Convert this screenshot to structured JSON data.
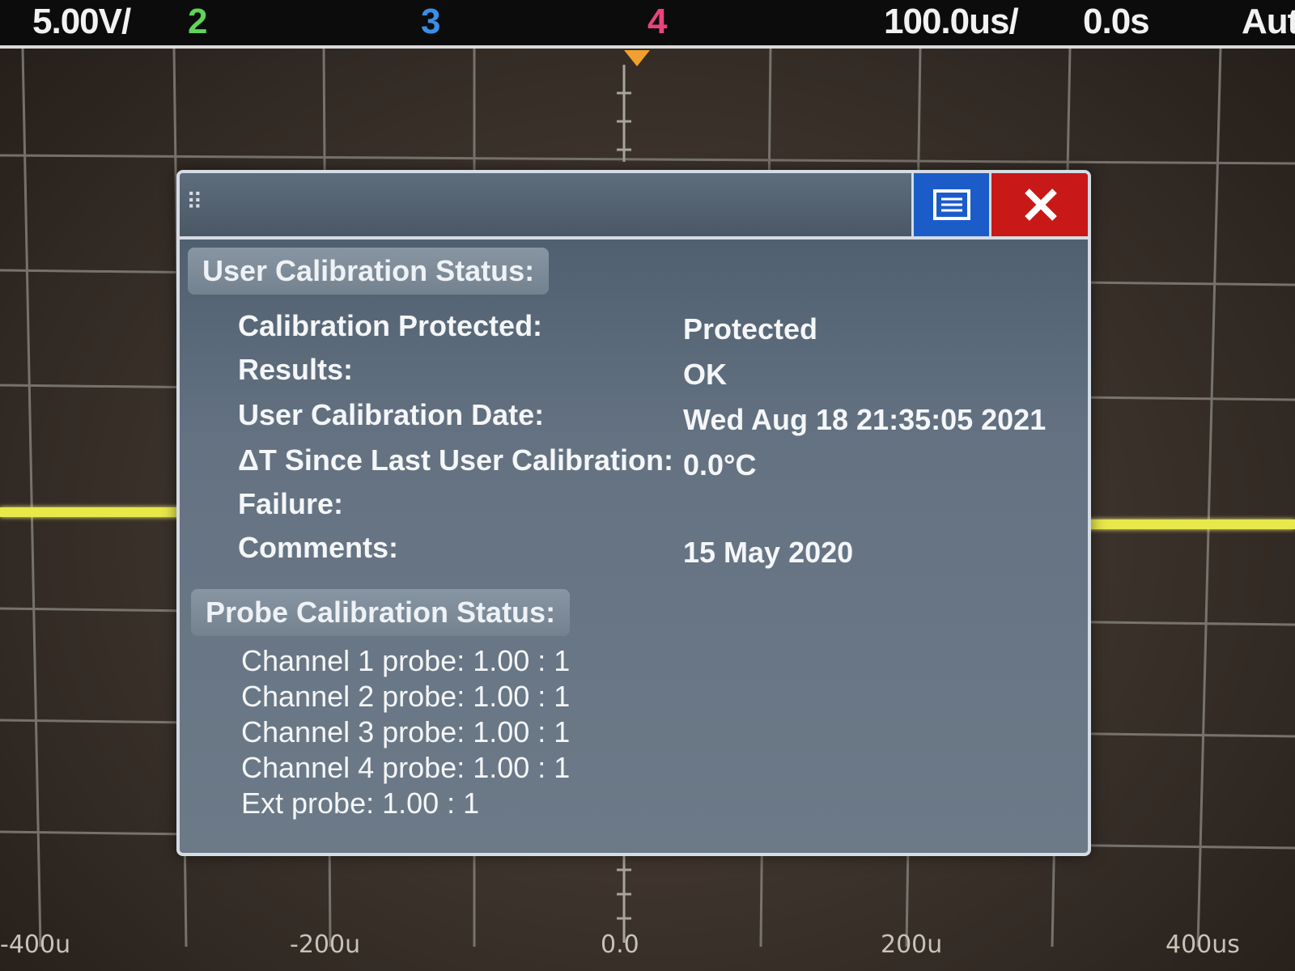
{
  "top_bar": {
    "ch1_scale": "5.00V/",
    "ch2": "2",
    "ch3": "3",
    "ch4": "4",
    "timebase": "100.0us/",
    "delay": "0.0s",
    "trigger_mode": "Auto"
  },
  "x_axis": {
    "ticks": [
      "-400u",
      "-200u",
      "0.0",
      "200u",
      "400us"
    ]
  },
  "dialog": {
    "user_calibration": {
      "header": "User Calibration Status:",
      "rows": [
        {
          "label": "Calibration Protected:",
          "value": "Protected"
        },
        {
          "label": "Results:",
          "value": "OK"
        },
        {
          "label": "User Calibration Date:",
          "value": "Wed Aug 18 21:35:05 2021"
        },
        {
          "label": "ΔT Since Last User Calibration:",
          "value": "0.0°C"
        },
        {
          "label": "Failure:",
          "value": ""
        },
        {
          "label": "Comments:",
          "value": "15 May 2020"
        }
      ]
    },
    "probe_calibration": {
      "header": "Probe Calibration Status:",
      "lines": [
        "Channel 1 probe: 1.00 : 1",
        "Channel 2 probe: 1.00 : 1",
        "Channel 3 probe: 1.00 : 1",
        "Channel 4 probe: 1.00 : 1",
        "Ext probe: 1.00 : 1"
      ]
    },
    "icons": {
      "grip": "drag-grip-icon",
      "menu": "menu-icon",
      "close": "close-icon"
    }
  },
  "colors": {
    "trace": "#e8e84a",
    "ch2": "#5fd35a",
    "ch3": "#3a8ee8",
    "ch4": "#e8447a",
    "menu_button": "#1c5cc8",
    "close_button": "#c81818"
  }
}
